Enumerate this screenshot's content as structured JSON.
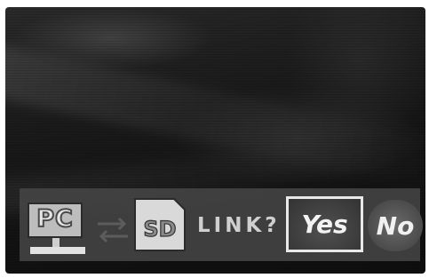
{
  "dialog": {
    "source_device": "PC",
    "target_device": "SD",
    "prompt": "LINK?",
    "confirm_label": "Yes",
    "cancel_label": "No",
    "selected": "Yes"
  },
  "icons": {
    "source": "pc-monitor-icon",
    "transfer": "bidirectional-arrows-icon",
    "target": "sd-card-icon"
  },
  "colors": {
    "screen_background": "#1a1a1a",
    "osd_bar": "#464646",
    "highlight_border": "#e8e8e8",
    "text": "#cfcfcf"
  }
}
